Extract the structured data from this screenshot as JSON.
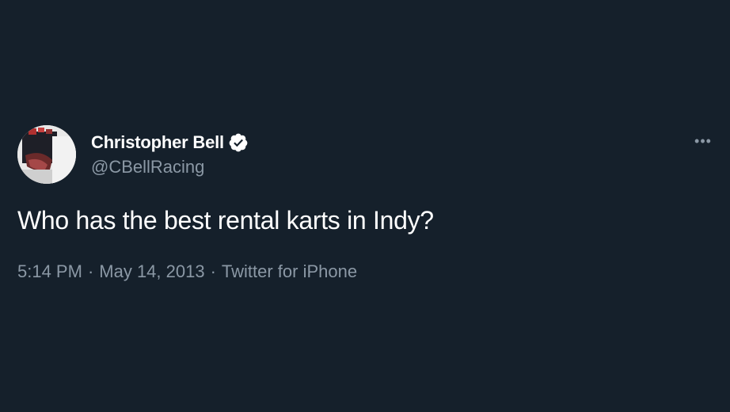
{
  "tweet": {
    "author": {
      "display_name": "Christopher Bell",
      "handle": "@CBellRacing",
      "verified_icon": "verified-badge-icon"
    },
    "text": "Who has the best rental karts in Indy?",
    "meta": {
      "time": "5:14 PM",
      "separator": "·",
      "date": "May 14, 2013",
      "source": "Twitter for iPhone"
    },
    "more_icon": "more-options-icon",
    "more_glyph": "•••"
  },
  "colors": {
    "background": "#15202b",
    "text_primary": "#ffffff",
    "text_secondary": "#8b98a5"
  }
}
